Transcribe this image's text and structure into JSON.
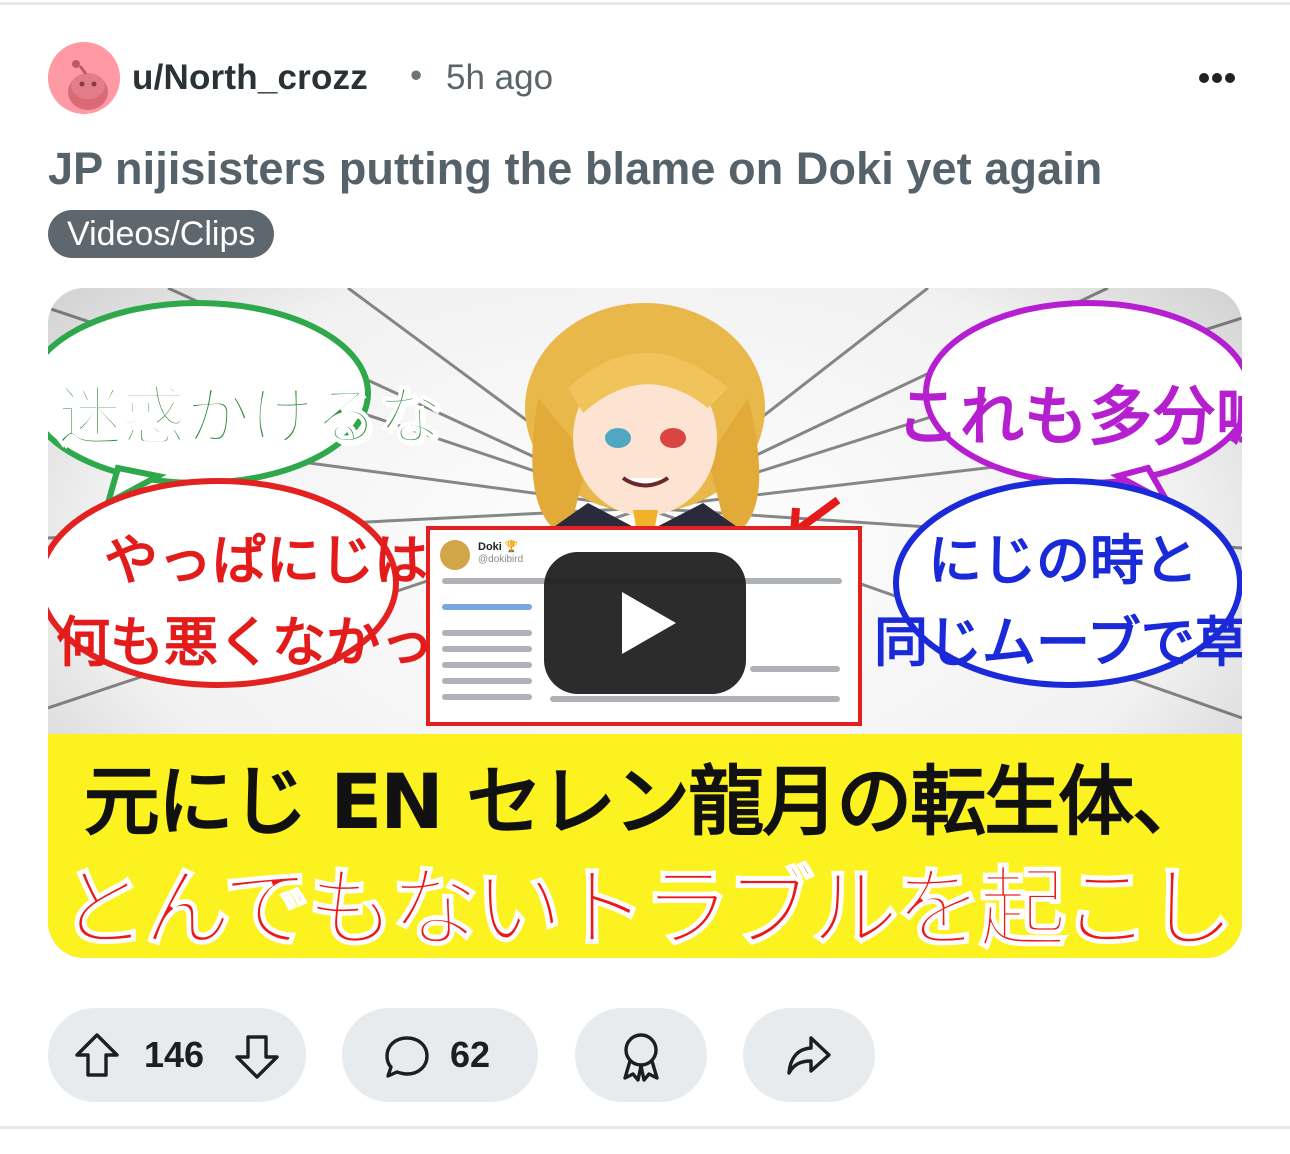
{
  "post": {
    "author": "u/North_crozz",
    "separator": "•",
    "age": "5h ago",
    "title": "JP nijisisters putting the blame on Doki yet again",
    "flair": "Videos/Clips"
  },
  "thumbnail": {
    "bubble_green": "迷惑かけるな",
    "bubble_red_line1": "やっぱにじは",
    "bubble_red_line2": "何も悪くなかった",
    "bubble_purple": "これも多分嘘",
    "bubble_blue_line1": "にじの時と",
    "bubble_blue_line2": "同じムーブで草",
    "banner_line1": "元にじ EN セレン龍月の転生体、",
    "banner_line2": "とんでもないトラブルを起こしてしまう",
    "tweet_name": "Doki 🏆",
    "tweet_handle": "@dokibird"
  },
  "actions": {
    "upvotes": "146",
    "comments": "62"
  },
  "icons": {
    "more": "more-options-icon",
    "upvote": "upvote-icon",
    "downvote": "downvote-icon",
    "comment": "comment-icon",
    "award": "award-icon",
    "share": "share-icon",
    "play": "play-icon"
  },
  "colors": {
    "flair_bg": "#5e676d",
    "pill_bg": "#e8ebed",
    "banner_yellow": "#fbf21f",
    "banner_red": "#ea1a1a",
    "avatar_pink": "#ff9aa5"
  }
}
